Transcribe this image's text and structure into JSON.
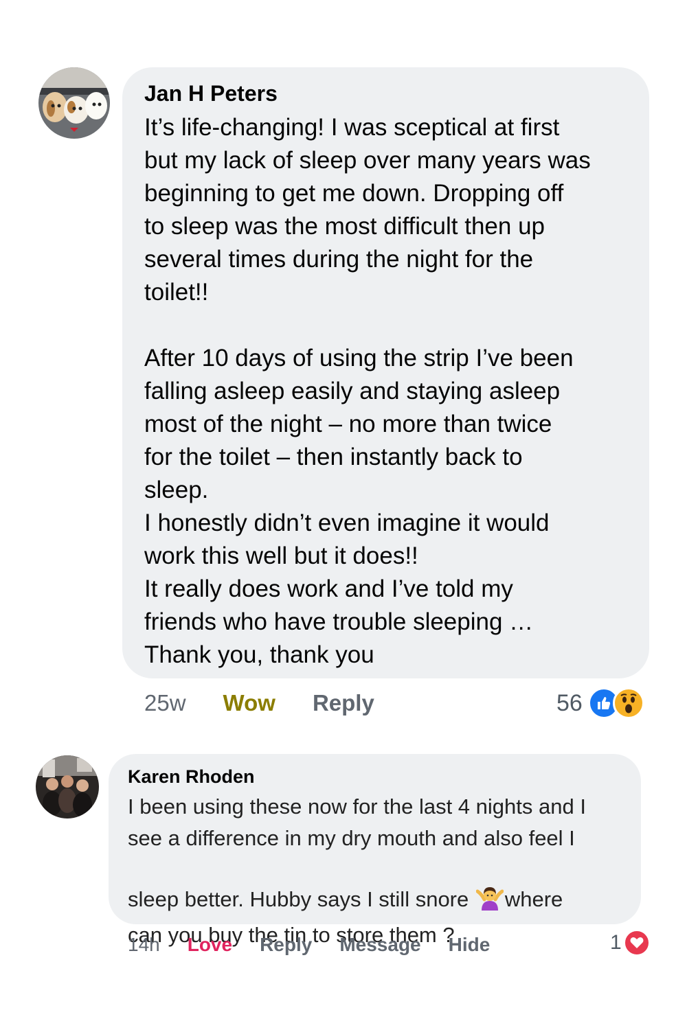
{
  "comments": [
    {
      "author": "Jan H Peters",
      "avatar_icon": "dogs-avatar-icon",
      "text": "It’s life-changing!  I was sceptical at first\nbut my lack of sleep over many years was\nbeginning to get me down.  Dropping off\nto sleep was the most difficult then up\nseveral times during the night for the\ntoilet!!\n\nAfter 10 days of using the strip I’ve been\nfalling asleep easily and staying asleep\nmost of the night – no more than twice\nfor the toilet – then instantly back to\nsleep.\nI honestly didn’t even imagine it would\nwork this well but it does!!\nIt really does work and I’ve told my\nfriends who have trouble sleeping …\nThank you, thank you",
      "time": "25w",
      "reaction_label": "Wow",
      "reply_label": "Reply",
      "reaction_count": "56",
      "reaction_icons": [
        "like-icon",
        "wow-icon"
      ],
      "reaction_color": "#8b7d00"
    },
    {
      "author": "Karen Rhoden",
      "avatar_icon": "group-photo-avatar-icon",
      "text_before_emoji": "I been using these now for the last 4 nights and I\nsee a difference in my dry mouth and also feel I\nsleep better. Hubby says I still snore ",
      "emoji_icon": "person-shrugging-emoji-icon",
      "text_after_emoji": "where\ncan you buy the tin to store them ?",
      "time": "14h",
      "reaction_label": "Love",
      "reply_label": "Reply",
      "message_label": "Message",
      "hide_label": "Hide",
      "reaction_count": "1",
      "reaction_icons": [
        "love-icon"
      ],
      "reaction_color": "#e0245e"
    }
  ],
  "colors": {
    "bubble": "#eef0f2",
    "meta_text": "#606770",
    "like_blue": "#1877f2",
    "love_red": "#e8384f",
    "wow_yellow": "#f7b125"
  }
}
